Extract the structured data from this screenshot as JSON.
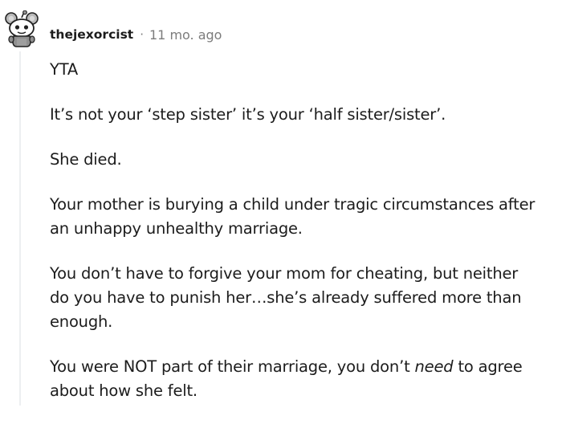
{
  "comment": {
    "author": "thejexorcist",
    "separator": "·",
    "timestamp": "11 mo. ago",
    "avatar_icon": "snoo-avatar-icon",
    "paragraphs": [
      [
        "YTA"
      ],
      [
        "It’s not your ‘step sister’ it’s your ‘half sister/sister’."
      ],
      [
        "She died."
      ],
      [
        "Your mother is burying a child under tragic circumstances after",
        "an unhappy unhealthy marriage."
      ],
      [
        "You don’t have to forgive your mom for cheating, but neither",
        "do you have to punish her…she’s already suffered more than",
        "enough."
      ]
    ],
    "last_paragraph": {
      "line1_before": "You were NOT part of their marriage, you don’t ",
      "line1_emphasis": "need",
      "line1_after": " to agree",
      "line2": "about how she felt."
    }
  },
  "colors": {
    "text": "#1c1c1c",
    "meta": "#7c7c7c",
    "thread_line": "#edeff1"
  }
}
